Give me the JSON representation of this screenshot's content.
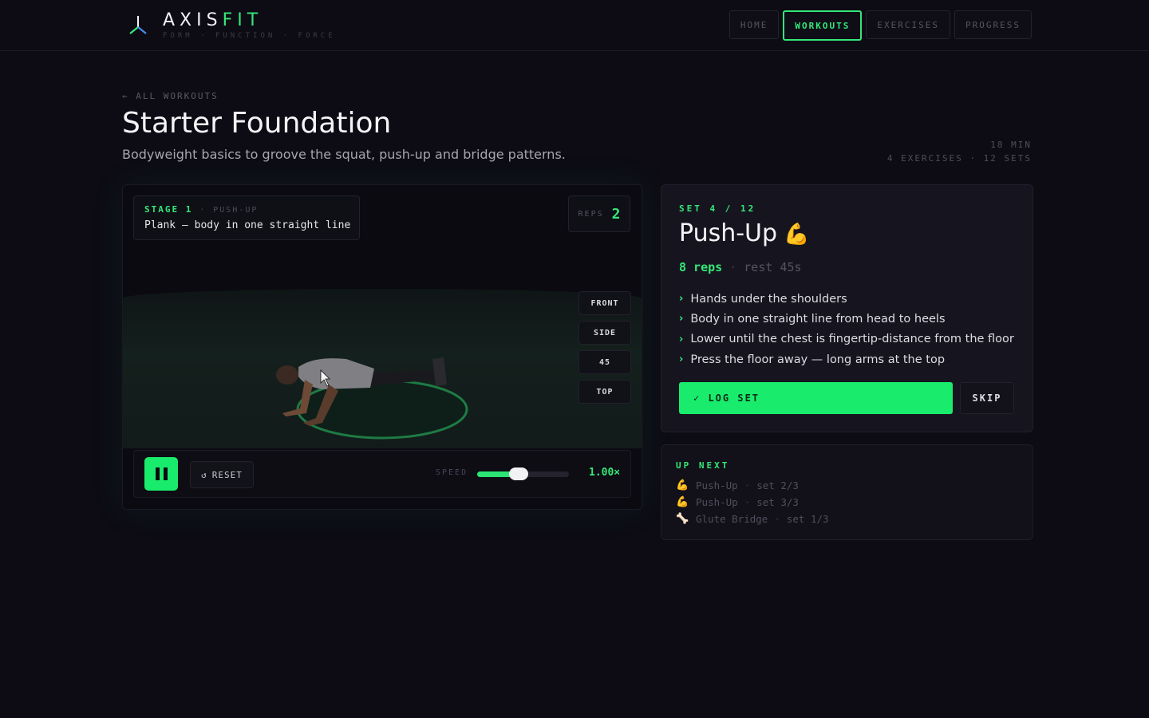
{
  "header": {
    "brand_main": "AXIS",
    "brand_accent": "FIT",
    "tagline": "FORM · FUNCTION · FORCE",
    "nav": [
      {
        "label": "HOME",
        "active": false
      },
      {
        "label": "WORKOUTS",
        "active": true
      },
      {
        "label": "EXERCISES",
        "active": false
      },
      {
        "label": "PROGRESS",
        "active": false
      }
    ]
  },
  "page": {
    "back_label": "← ALL WORKOUTS",
    "title": "Starter Foundation",
    "subtitle": "Bodyweight basics to groove the squat, push-up and bridge patterns.",
    "duration": "18 MIN",
    "summary": "4 EXERCISES · 12 SETS"
  },
  "viewer": {
    "stage_label": "STAGE 1",
    "stage_sep": "·",
    "stage_exercise": "PUSH-UP",
    "stage_cue": "Plank — body in one straight line",
    "reps_label": "REPS",
    "reps_value": "2",
    "views": [
      "FRONT",
      "SIDE",
      "45",
      "TOP"
    ],
    "controls": {
      "reset_icon": "↺",
      "reset_label": "RESET",
      "speed_label": "SPEED",
      "speed_value": "1.00×",
      "speed_level": 0.45
    }
  },
  "set_card": {
    "set_count": "SET 4 / 12",
    "exercise": "Push-Up",
    "emoji": "💪",
    "reps": "8 reps",
    "sep": "·",
    "rest": "rest 45s",
    "cues": [
      "Hands under the shoulders",
      "Body in one straight line from head to heels",
      "Lower until the chest is fingertip-distance from the floor",
      "Press the floor away — long arms at the top"
    ],
    "log_label": "✓ LOG SET",
    "skip_label": "SKIP"
  },
  "up_next": {
    "title": "UP NEXT",
    "items": [
      {
        "icon": "💪",
        "name": "Push-Up",
        "set": "set 2/3"
      },
      {
        "icon": "💪",
        "name": "Push-Up",
        "set": "set 3/3"
      },
      {
        "icon": "🦴",
        "name": "Glute Bridge",
        "set": "set 1/3"
      }
    ]
  },
  "colors": {
    "accent": "#35e878",
    "button_green": "#19ec6c",
    "background": "#0d0c15",
    "card": "#16151f"
  }
}
